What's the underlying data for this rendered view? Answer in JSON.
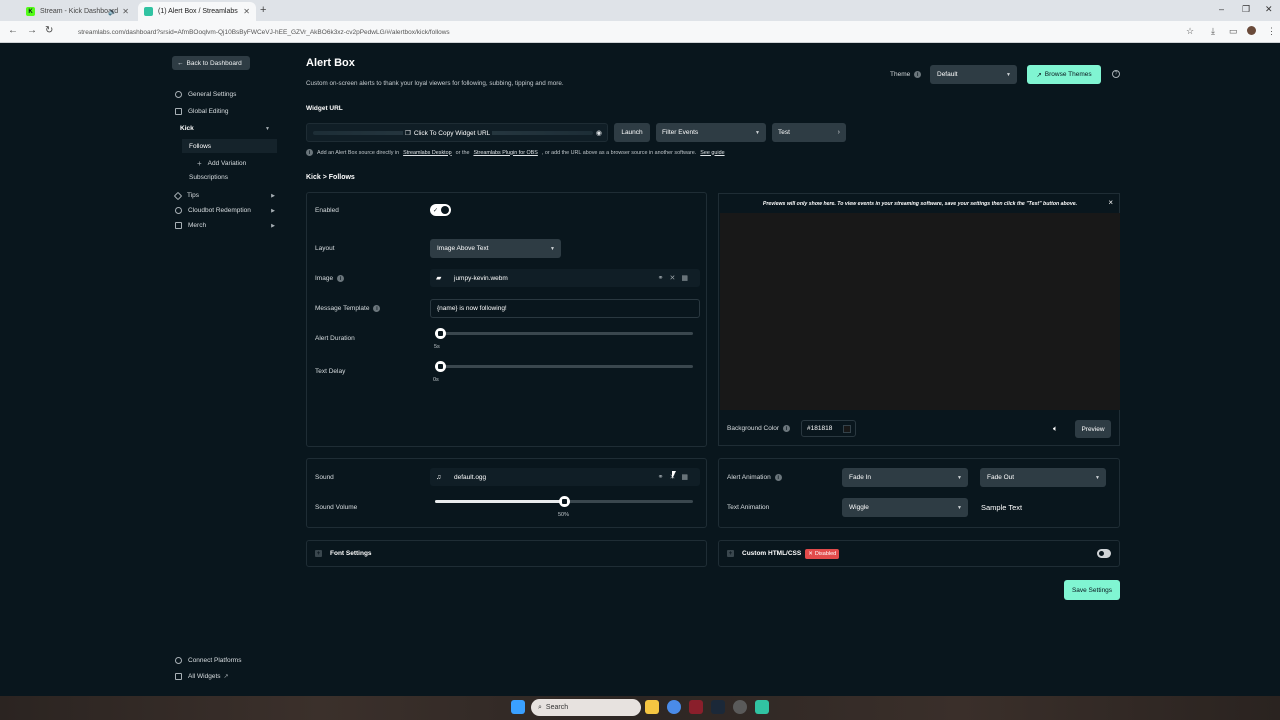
{
  "browser": {
    "tabs": [
      {
        "title": "Stream - Kick Dashboard",
        "favicon_color": "#53fc18",
        "active": false
      },
      {
        "title": "(1) Alert Box / Streamlabs",
        "favicon_color": "#31c3a2",
        "active": true
      }
    ],
    "new_tab": "+",
    "address": "streamlabs.com/dashboard?srsid=AfmBOoqlvm-Qj10BsByFWCeVJ-hEE_GZVr_AkBO6k3xz-cv2pPedwLG/#/alertbox/kick/follows"
  },
  "sidebar": {
    "back_label": "Back to Dashboard",
    "items": [
      {
        "label": "General Settings",
        "icon": "gear-icon"
      },
      {
        "label": "Global Editing",
        "icon": "grid-icon"
      },
      {
        "label": "Kick",
        "icon": ""
      },
      {
        "label": "Follows",
        "icon": ""
      },
      {
        "label": "Add Variation",
        "icon": "plus-icon"
      },
      {
        "label": "Subscriptions",
        "icon": ""
      },
      {
        "label": "Tips",
        "icon": "tag-icon"
      },
      {
        "label": "Cloudbot Redemption",
        "icon": "gear-icon"
      },
      {
        "label": "Merch",
        "icon": "cart-icon"
      }
    ],
    "bottom": [
      {
        "label": "Connect Platforms",
        "icon": "link-icon"
      },
      {
        "label": "All Widgets",
        "icon": "grid-icon"
      }
    ]
  },
  "header": {
    "title": "Alert Box",
    "description": "Custom on-screen alerts to thank your loyal viewers for following, subbing, tipping and more.",
    "theme_label": "Theme",
    "theme_value": "Default",
    "browse_themes": "Browse Themes",
    "help": "?"
  },
  "widget_url": {
    "label": "Widget URL",
    "copy_label": "Click To Copy Widget URL",
    "launch": "Launch",
    "filter_events": "Filter Events",
    "test": "Test",
    "hint_prefix": "Add an Alert Box source directly in",
    "hint_link1": "Streamlabs Desktop",
    "hint_or": "or the",
    "hint_link2": "Streamlabs Plugin for OBS",
    "hint_suffix": ", or add the URL above as a browser source in another software.",
    "hint_link3": "See guide"
  },
  "breadcrumb": "Kick > Follows",
  "settings": {
    "enabled_label": "Enabled",
    "enabled": true,
    "layout_label": "Layout",
    "layout_value": "Image Above Text",
    "image_label": "Image",
    "image_file": "jumpy-kevin.webm",
    "message_label": "Message Template",
    "message_value": "{name} is now following!",
    "duration_label": "Alert Duration",
    "duration_value": "5s",
    "duration_fraction": 0.0,
    "delay_label": "Text Delay",
    "delay_value": "0s",
    "delay_fraction": 0.0
  },
  "preview": {
    "note": "Previews will only show here. To view events in your streaming software, save your settings then click the \"Test\" button above.",
    "close": "×",
    "bg_label": "Background Color",
    "bg_value": "#181818",
    "preview_button": "Preview"
  },
  "sound": {
    "label": "Sound",
    "file": "default.ogg",
    "volume_label": "Sound Volume",
    "volume_value": "50%",
    "volume_fraction": 0.5
  },
  "animation": {
    "alert_label": "Alert Animation",
    "alert_in": "Fade In",
    "alert_out": "Fade Out",
    "text_label": "Text Animation",
    "text_value": "Wiggle",
    "sample_text": "Sample Text"
  },
  "accordions": {
    "font_settings": "Font Settings",
    "custom_html": "Custom HTML/CSS",
    "disabled_badge": "Disabled"
  },
  "save_label": "Save Settings",
  "taskbar": {
    "search_placeholder": "Search"
  },
  "colors": {
    "accent": "#80f5d2",
    "background": "#09161d",
    "danger": "#e24b4b"
  }
}
